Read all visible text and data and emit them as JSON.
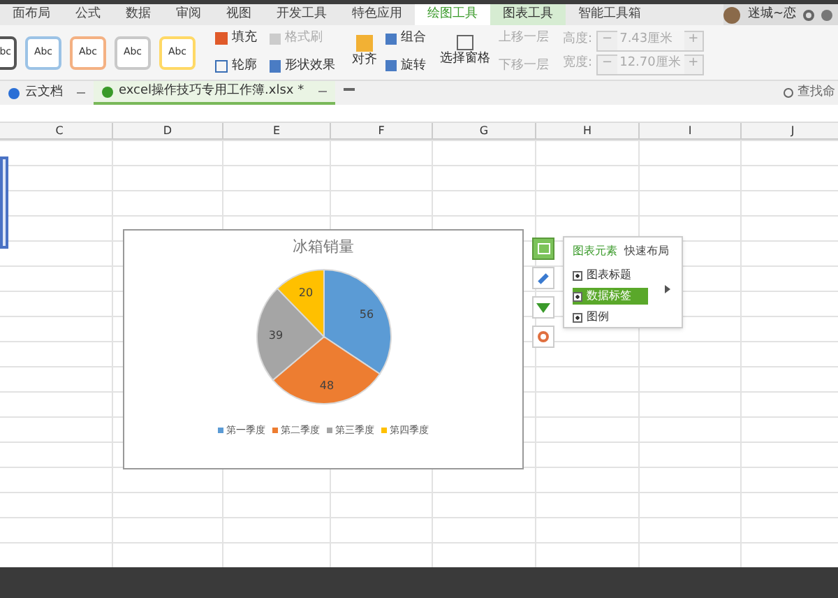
{
  "menu_tabs": [
    {
      "label": "面布局",
      "selected": false
    },
    {
      "label": "公式",
      "selected": false
    },
    {
      "label": "数据",
      "selected": false
    },
    {
      "label": "审阅",
      "selected": false
    },
    {
      "label": "视图",
      "selected": false
    },
    {
      "label": "开发工具",
      "selected": false
    },
    {
      "label": "特色应用",
      "selected": false
    },
    {
      "label": "绘图工具",
      "selected": true
    },
    {
      "label": "图表工具",
      "selected": false
    },
    {
      "label": "智能工具箱",
      "selected": false
    }
  ],
  "user": {
    "name": "迷城~恋"
  },
  "ribbon": {
    "styles": [
      {
        "label": "bc",
        "color": "#555555"
      },
      {
        "label": "Abc",
        "color": "#9cc3e6"
      },
      {
        "label": "Abc",
        "color": "#f4b183"
      },
      {
        "label": "Abc",
        "color": "#c9c9c9"
      },
      {
        "label": "Abc",
        "color": "#ffd966"
      }
    ],
    "fill": "填充",
    "format_painter": "格式刷",
    "outline": "轮廓",
    "shape_effects": "形状效果",
    "align": "对齐",
    "group": "组合",
    "rotate": "旋转",
    "selection_pane": "选择窗格",
    "bring_forward": "上移一层",
    "send_backward": "下移一层",
    "height": {
      "label": "高度:",
      "value": "7.43厘米",
      "minus": "−",
      "plus": "+"
    },
    "width": {
      "label": "宽度:",
      "value": "12.70厘米",
      "minus": "−",
      "plus": "+"
    }
  },
  "doc_tabs": [
    {
      "label": "云文档",
      "selected": false
    },
    {
      "label": "excel操作技巧专用工作簿.xlsx *",
      "selected": true
    }
  ],
  "search": {
    "placeholder": "查找命"
  },
  "columns": [
    "C",
    "D",
    "E",
    "F",
    "G",
    "H",
    "I",
    "J"
  ],
  "chart": {
    "chart_data": {
      "type": "pie",
      "title": "冰箱销量",
      "categories": [
        "第一季度",
        "第二季度",
        "第三季度",
        "第四季度"
      ],
      "values": [
        56,
        48,
        39,
        20
      ],
      "colors": [
        "#5b9bd5",
        "#ed7d31",
        "#a5a5a5",
        "#ffc000"
      ],
      "data_labels": true
    }
  },
  "chart_elements": {
    "tabs": [
      {
        "label": "图表元素",
        "selected": true
      },
      {
        "label": "快速布局",
        "selected": false
      }
    ],
    "items": [
      {
        "label": "图表标题",
        "checked": true,
        "selected": false
      },
      {
        "label": "数据标签",
        "checked": true,
        "selected": true
      },
      {
        "label": "图例",
        "checked": true,
        "selected": false
      }
    ]
  }
}
